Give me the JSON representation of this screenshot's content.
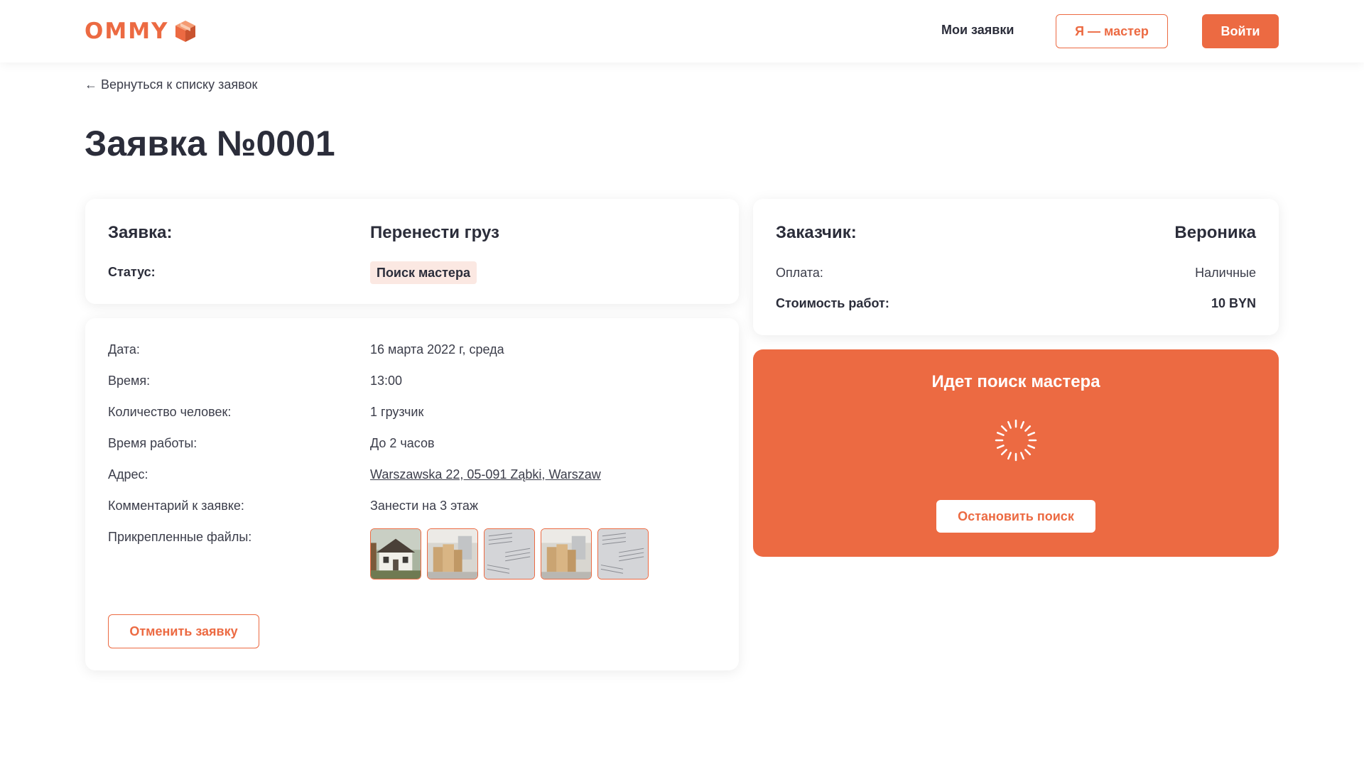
{
  "header": {
    "logo_text": "OMMY",
    "nav_my_requests": "Мои заявки",
    "master_button": "Я — мастер",
    "login_button": "Войти"
  },
  "back_link": "← Вернуться к списку заявок",
  "page_title": "Заявка №0001",
  "request_card": {
    "request_label": "Заявка:",
    "request_value": "Перенести груз",
    "status_label": "Статус:",
    "status_value": "Поиск мастера"
  },
  "details": [
    {
      "label": "Дата:",
      "value": "16 марта 2022 г, среда"
    },
    {
      "label": "Время:",
      "value": "13:00"
    },
    {
      "label": "Количество человек:",
      "value": "1 грузчик"
    },
    {
      "label": "Время работы:",
      "value": "До 2 часов"
    },
    {
      "label": "Адрес:",
      "value": "Warszawska 22, 05-091 Ząbki, Warszaw"
    },
    {
      "label": "Комментарий к заявке:",
      "value": "Занести на 3 этаж"
    },
    {
      "label": "Прикрепленные файлы:",
      "value": ""
    }
  ],
  "attachments": [
    "house-photo",
    "boxes-photo",
    "documents-photo",
    "boxes-photo",
    "documents-photo"
  ],
  "cancel_button": "Отменить заявку",
  "customer_card": {
    "customer_label": "Заказчик:",
    "customer_value": "Вероника",
    "payment_label": "Оплата:",
    "payment_value": "Наличные",
    "cost_label": "Стоимость работ:",
    "cost_value": "10 BYN"
  },
  "search_card": {
    "title": "Идет поиск мастера",
    "stop_button": "Остановить поиск"
  },
  "colors": {
    "accent": "#ec6a42",
    "badge_bg": "#fbe8e2",
    "text_dark": "#2b2d3a"
  },
  "icons": {
    "logo": "cube-icon",
    "back": "arrow-left-icon",
    "loading": "spinner-icon"
  }
}
